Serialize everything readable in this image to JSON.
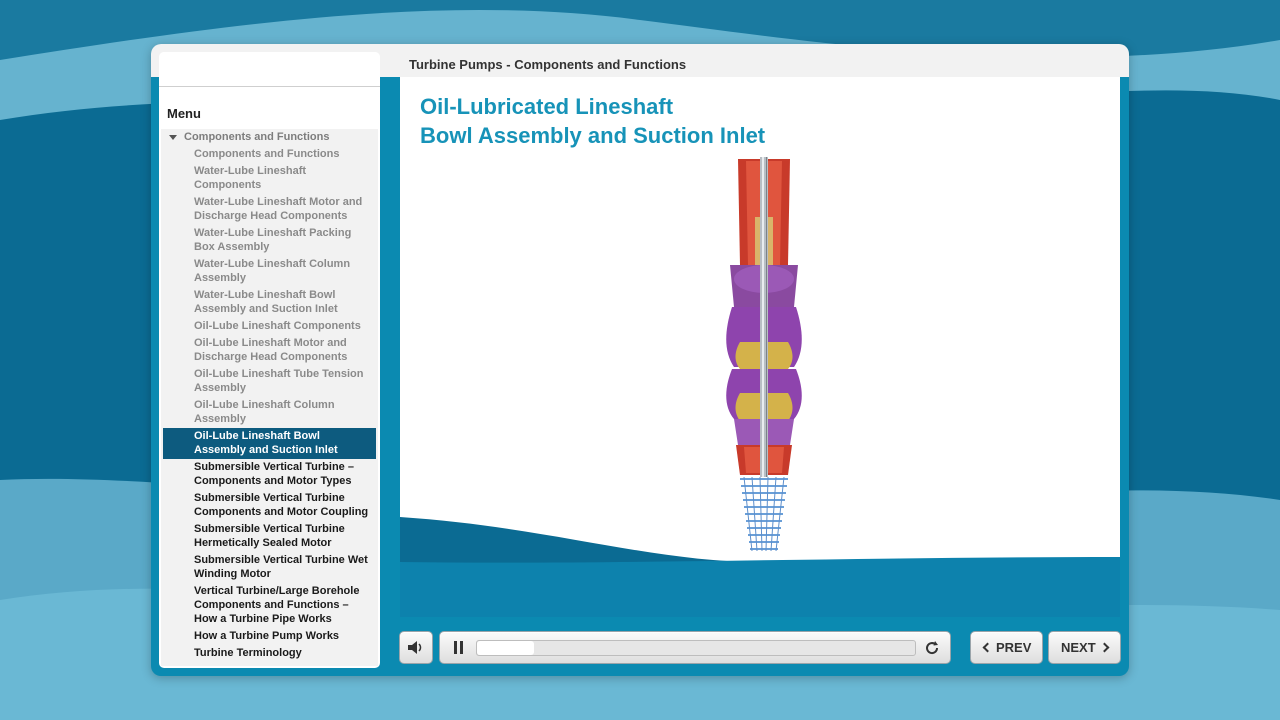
{
  "course_title": "Turbine Pumps - Components and Functions",
  "slide": {
    "title_line1": "Oil-Lubricated Lineshaft",
    "title_line2": "Bowl Assembly and Suction Inlet"
  },
  "sidebar": {
    "tab_label": "Menu",
    "parent_label": "Components and Functions",
    "items": [
      {
        "label": "Components and Functions",
        "state": "visited"
      },
      {
        "label": "Water-Lube Lineshaft Components",
        "state": "visited"
      },
      {
        "label": "Water-Lube Lineshaft Motor and Discharge Head Components",
        "state": "visited"
      },
      {
        "label": "Water-Lube Lineshaft Packing Box Assembly",
        "state": "visited"
      },
      {
        "label": "Water-Lube Lineshaft Column Assembly",
        "state": "visited"
      },
      {
        "label": "Water-Lube Lineshaft Bowl Assembly and Suction Inlet",
        "state": "visited"
      },
      {
        "label": "Oil-Lube Lineshaft Components",
        "state": "visited"
      },
      {
        "label": "Oil-Lube Lineshaft Motor and Discharge Head Components",
        "state": "visited"
      },
      {
        "label": "Oil-Lube Lineshaft Tube Tension Assembly",
        "state": "visited"
      },
      {
        "label": "Oil-Lube Lineshaft Column Assembly",
        "state": "visited"
      },
      {
        "label": "Oil-Lube Lineshaft Bowl Assembly and Suction Inlet",
        "state": "current"
      },
      {
        "label": "Submersible Vertical Turbine – Components and Motor Types",
        "state": "upcoming"
      },
      {
        "label": "Submersible Vertical Turbine Components and Motor Coupling",
        "state": "upcoming"
      },
      {
        "label": "Submersible Vertical Turbine Hermetically Sealed Motor",
        "state": "upcoming"
      },
      {
        "label": "Submersible Vertical Turbine Wet Winding Motor",
        "state": "upcoming"
      },
      {
        "label": "Vertical Turbine/Large Borehole Components and Functions – How a Turbine Pipe Works",
        "state": "upcoming"
      },
      {
        "label": "How a Turbine Pump Works",
        "state": "upcoming"
      },
      {
        "label": "Turbine Terminology",
        "state": "upcoming"
      }
    ]
  },
  "controls": {
    "prev_label": "PREV",
    "next_label": "NEXT",
    "progress_fraction": 0.13,
    "icons": [
      "speaker-icon",
      "pause-icon",
      "replay-icon",
      "chevron-left-icon",
      "chevron-right-icon"
    ]
  },
  "colors": {
    "accent": "#1793b8",
    "current_item": "#0d5b7f",
    "player_frame": "#0b8ab1"
  }
}
